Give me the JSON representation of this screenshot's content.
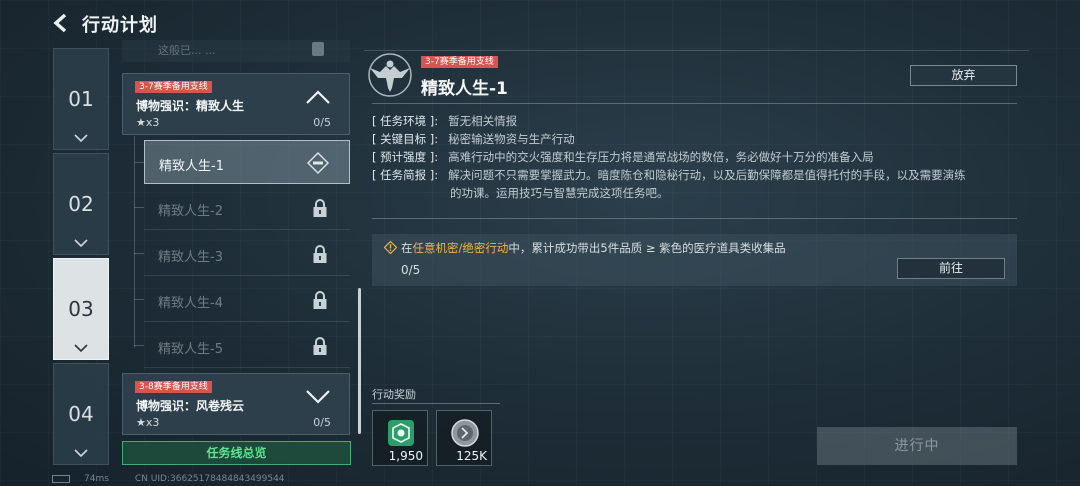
{
  "header": {
    "title": "行动计划"
  },
  "chapters": [
    {
      "num": "01"
    },
    {
      "num": "02"
    },
    {
      "num": "03",
      "active": true
    },
    {
      "num": "04"
    }
  ],
  "quest_list": {
    "prev_item_text": "这般已...  ...",
    "current_quest": {
      "tag": "3-7赛季备用支线",
      "name": "博物强识：精致人生",
      "stars": "★x3",
      "progress": "0/5"
    },
    "sub_quests": [
      {
        "label": "精致人生-1",
        "state": "active"
      },
      {
        "label": "精致人生-2",
        "state": "locked"
      },
      {
        "label": "精致人生-3",
        "state": "locked"
      },
      {
        "label": "精致人生-4",
        "state": "locked"
      },
      {
        "label": "精致人生-5",
        "state": "locked"
      }
    ],
    "next_quest": {
      "tag": "3-8赛季备用支线",
      "name": "博物强识：风卷残云",
      "stars": "★x3",
      "progress": "0/5"
    },
    "overview_button": "任务线总览"
  },
  "status_bar": {
    "ping": "74ms",
    "uid": "CN UID:36625178484843499544"
  },
  "detail": {
    "tag": "3-7赛季备用支线",
    "title": "精致人生-1",
    "abandon_button": "放弃",
    "env_key": "[ 任务环境 ]:",
    "env_val": "暂无相关情报",
    "goal_key": "[ 关键目标 ]:",
    "goal_val": "秘密输送物资与生产行动",
    "intensity_key": "[ 预计强度 ]:",
    "intensity_val": "高难行动中的交火强度和生存压力将是通常战场的数倍，务必做好十万分的准备入局",
    "brief_key": "[ 任务简报 ]:",
    "brief_val_line1": "解决问题不只需要掌握武力。暗度陈仓和隐秘行动，以及后勤保障都是值得托付的手段，以及需要演练",
    "brief_val_line2": "的功课。运用技巧与智慧完成这项任务吧。",
    "task": {
      "text_pre": "在",
      "text_hl": "任意机密/绝密行动",
      "text_post": "中，累计成功带出5件品质 ≥ 紫色的医疗道具类收集品",
      "progress": "0/5",
      "goto_button": "前往"
    },
    "reward_label": "行动奖励",
    "rewards": [
      {
        "icon": "green-badge-icon",
        "qty": "1,950"
      },
      {
        "icon": "silver-coin-icon",
        "qty": "125K"
      }
    ],
    "status_button": "进行中"
  },
  "colors": {
    "season_tag": "#d9534f",
    "highlight": "#f0b544",
    "overview_green": "#5be38f"
  }
}
